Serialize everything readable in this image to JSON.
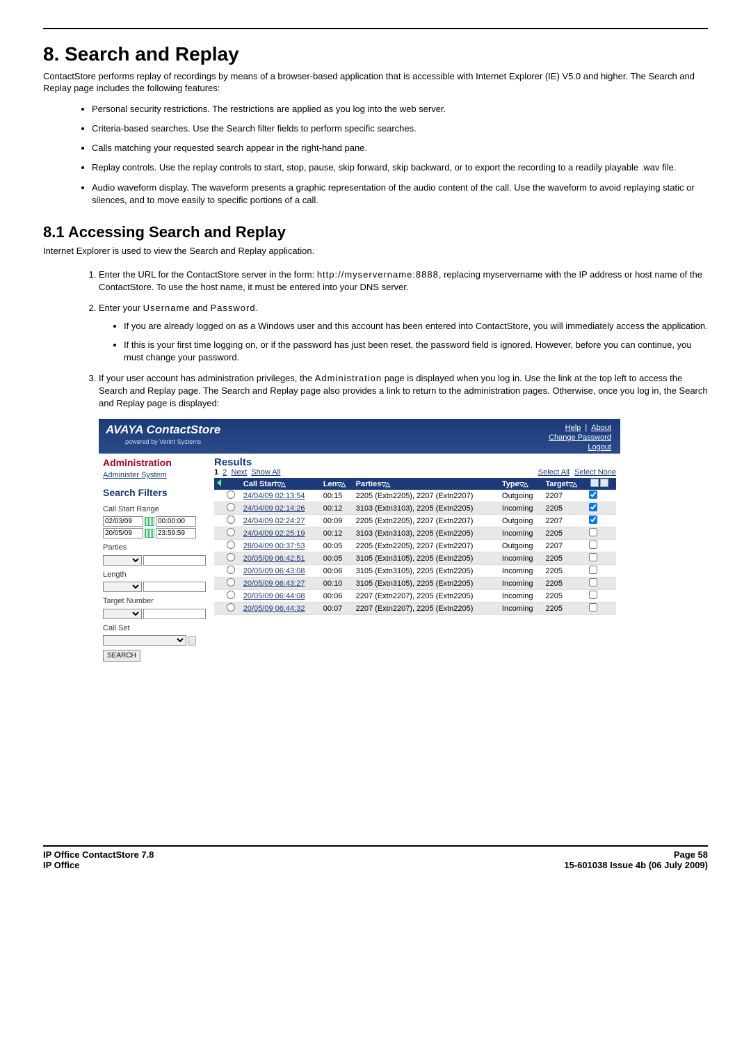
{
  "heading": "8. Search and Replay",
  "intro": "ContactStore performs replay of recordings by means of a browser-based application that is accessible with Internet Explorer (IE) V5.0 and higher. The Search and Replay page includes the following features:",
  "features": [
    "Personal security restrictions. The restrictions are applied as you log into the web server.",
    "Criteria-based searches. Use the Search filter fields to perform specific searches.",
    "Calls matching your requested search appear in the right-hand pane.",
    "Replay controls. Use the replay controls to start, stop, pause, skip forward, skip backward, or to export the recording to a readily playable .wav file.",
    "Audio waveform display. The waveform presents a graphic representation of the audio content of the call. Use the waveform to avoid replaying static or silences, and to move easily to specific portions of a call."
  ],
  "subhead": "8.1 Accessing Search and Replay",
  "subintro": "Internet Explorer is used to view the Search and Replay application.",
  "step1_a": "Enter the URL for the ContactStore server in the form: ",
  "step1_b": "http://myservername:8888",
  "step1_c": ", replacing myservername with the IP address or host name of the ContactStore. To use the host name, it must be entered into your DNS server.",
  "step2_a": "Enter your ",
  "step2_b": "Username",
  "step2_c": " and ",
  "step2_d": "Password",
  "step2_e": ".",
  "step2_bullets": [
    "If you are already logged on as a Windows user and this account has been entered into ContactStore, you will immediately access the application.",
    "If this is your first time logging on, or if the password has just been reset, the password field is ignored. However, before you can continue, you must change your password."
  ],
  "step3_a": "If your user account has administration privileges, the ",
  "step3_b": "Administration",
  "step3_c": " page is displayed when you log in. Use the link at the top left to access the Search and Replay page. The Search and Replay page also provides a link to return to the administration pages. Otherwise, once you log in, the Search and Replay page is displayed:",
  "logo_main": "AVAYA ContactStore",
  "logo_sub": "powered by Verint Systems",
  "banner_links": {
    "help": "Help",
    "about": "About",
    "change_pw": "Change Password",
    "logout": "Logout"
  },
  "sidebar": {
    "admin": "Administration",
    "admin_link": "Administer System",
    "filters_head": "Search Filters",
    "labels": {
      "call_start": "Call Start Range",
      "parties": "Parties",
      "length": "Length",
      "target": "Target Number",
      "call_set": "Call Set"
    },
    "start_date": "02/03/09",
    "start_time": "00:00:00",
    "end_date": "20/05/09",
    "end_time": "23:59:59",
    "search": "SEARCH"
  },
  "results": {
    "head": "Results",
    "paging": {
      "p1": "1",
      "p2": "2",
      "next": "Next",
      "show_all": "Show All",
      "sel_all": "Select All",
      "sel_none": "Select None"
    },
    "cols": {
      "call_start": "Call Start",
      "len": "Len",
      "parties": "Parties",
      "type": "Type",
      "target": "Target"
    },
    "rows": [
      {
        "start": "24/04/09 02:13:54",
        "len": "00:15",
        "parties": "2205 (Extn2205), 2207 (Extn2207)",
        "type": "Outgoing",
        "target": "2207",
        "chk": true
      },
      {
        "start": "24/04/09 02:14:26",
        "len": "00:12",
        "parties": "3103 (Extn3103), 2205 (Extn2205)",
        "type": "Incoming",
        "target": "2205",
        "chk": true
      },
      {
        "start": "24/04/09 02:24:27",
        "len": "00:09",
        "parties": "2205 (Extn2205), 2207 (Extn2207)",
        "type": "Outgoing",
        "target": "2207",
        "chk": true
      },
      {
        "start": "24/04/09 02:25:19",
        "len": "00:12",
        "parties": "3103 (Extn3103), 2205 (Extn2205)",
        "type": "Incoming",
        "target": "2205",
        "chk": false
      },
      {
        "start": "28/04/09 00:37:53",
        "len": "00:05",
        "parties": "2205 (Extn2205), 2207 (Extn2207)",
        "type": "Outgoing",
        "target": "2207",
        "chk": false
      },
      {
        "start": "20/05/09 06:42:51",
        "len": "00:05",
        "parties": "3105 (Extn3105), 2205 (Extn2205)",
        "type": "Incoming",
        "target": "2205",
        "chk": false
      },
      {
        "start": "20/05/09 06:43:08",
        "len": "00:06",
        "parties": "3105 (Extn3105), 2205 (Extn2205)",
        "type": "Incoming",
        "target": "2205",
        "chk": false
      },
      {
        "start": "20/05/09 06:43:27",
        "len": "00:10",
        "parties": "3105 (Extn3105), 2205 (Extn2205)",
        "type": "Incoming",
        "target": "2205",
        "chk": false
      },
      {
        "start": "20/05/09 06:44:08",
        "len": "00:06",
        "parties": "2207 (Extn2207), 2205 (Extn2205)",
        "type": "Incoming",
        "target": "2205",
        "chk": false
      },
      {
        "start": "20/05/09 06:44:32",
        "len": "00:07",
        "parties": "2207 (Extn2207), 2205 (Extn2205)",
        "type": "Incoming",
        "target": "2205",
        "chk": false
      }
    ]
  },
  "footer": {
    "left1": "IP Office ContactStore 7.8",
    "left2": "IP Office",
    "right1": "Page 58",
    "right2": "15-601038 Issue 4b (06 July 2009)"
  }
}
